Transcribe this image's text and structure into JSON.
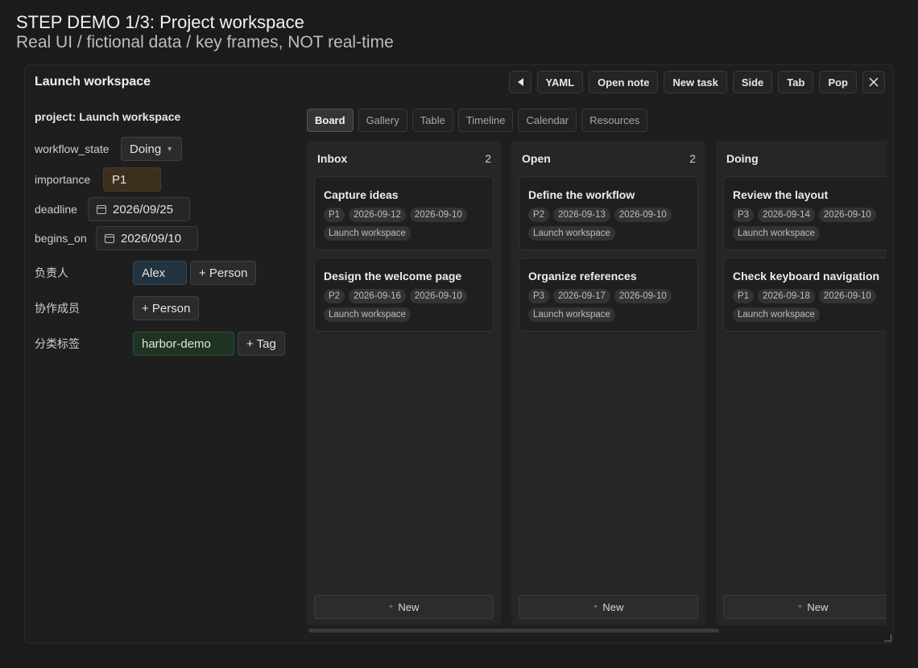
{
  "banner": {
    "title": "STEP DEMO 1/3: Project workspace",
    "subtitle": "Real UI / fictional data / key frames, NOT real-time"
  },
  "window": {
    "title": "Launch workspace",
    "toolbar": {
      "yaml": "YAML",
      "open_note": "Open note",
      "new_task": "New task",
      "side": "Side",
      "tab": "Tab",
      "pop": "Pop"
    }
  },
  "props": {
    "heading": "project: Launch workspace",
    "workflow_state": {
      "label": "workflow_state",
      "value": "Doing"
    },
    "importance": {
      "label": "importance",
      "value": "P1"
    },
    "deadline": {
      "label": "deadline",
      "value": "2026/09/25"
    },
    "begins_on": {
      "label": "begins_on",
      "value": "2026/09/10"
    },
    "owner": {
      "label": "负责人",
      "value": "Alex",
      "add": "+ Person"
    },
    "collaborators": {
      "label": "协作成员",
      "add": "+ Person"
    },
    "tags": {
      "label": "分类标签",
      "value": "harbor-demo",
      "add": "+ Tag"
    }
  },
  "tabs": [
    "Board",
    "Gallery",
    "Table",
    "Timeline",
    "Calendar",
    "Resources"
  ],
  "board": {
    "new_label": "New",
    "columns": [
      {
        "name": "Inbox",
        "count": "2",
        "cards": [
          {
            "title": "Capture ideas",
            "priority": "P1",
            "due": "2026-09-12",
            "start": "2026-09-10",
            "project": "Launch workspace"
          },
          {
            "title": "Design the welcome page",
            "priority": "P2",
            "due": "2026-09-16",
            "start": "2026-09-10",
            "project": "Launch workspace"
          }
        ]
      },
      {
        "name": "Open",
        "count": "2",
        "cards": [
          {
            "title": "Define the workflow",
            "priority": "P2",
            "due": "2026-09-13",
            "start": "2026-09-10",
            "project": "Launch workspace"
          },
          {
            "title": "Organize references",
            "priority": "P3",
            "due": "2026-09-17",
            "start": "2026-09-10",
            "project": "Launch workspace"
          }
        ]
      },
      {
        "name": "Doing",
        "count": "",
        "cards": [
          {
            "title": "Review the layout",
            "priority": "P3",
            "due": "2026-09-14",
            "start": "2026-09-10",
            "project": "Launch workspace"
          },
          {
            "title": "Check keyboard navigation",
            "priority": "P1",
            "due": "2026-09-18",
            "start": "2026-09-10",
            "project": "Launch workspace"
          }
        ]
      }
    ]
  }
}
